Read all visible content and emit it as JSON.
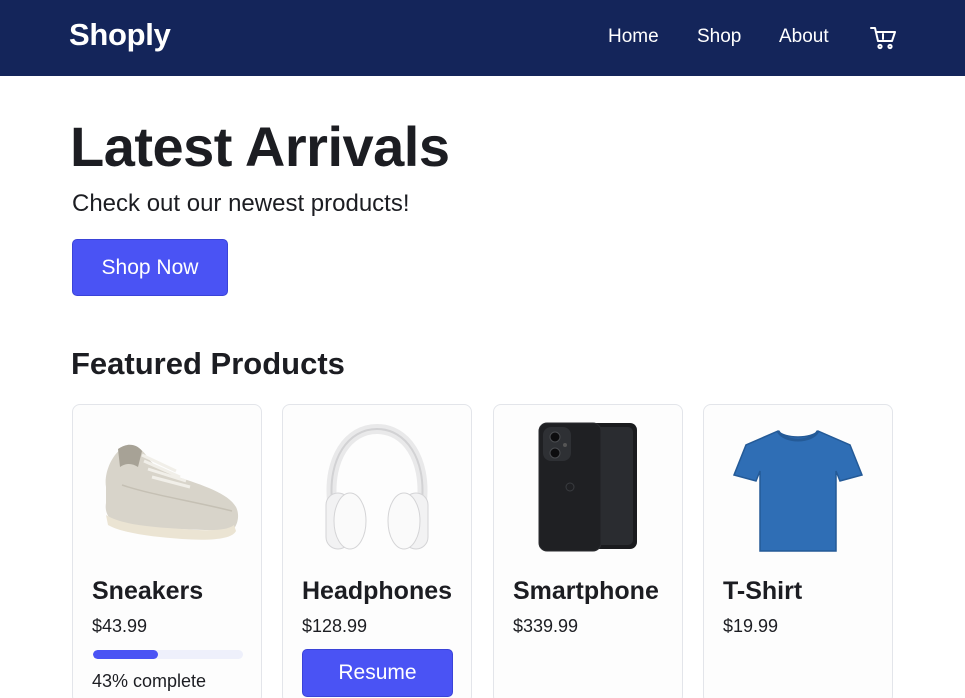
{
  "header": {
    "brand": "Shoply",
    "nav": [
      {
        "label": "Home"
      },
      {
        "label": "Shop"
      },
      {
        "label": "About"
      }
    ],
    "cart_icon": "cart-icon"
  },
  "hero": {
    "title": "Latest Arrivals",
    "subtitle": "Check out our newest products!",
    "cta_label": "Shop Now"
  },
  "featured": {
    "title": "Featured Products",
    "products": [
      {
        "name": "Sneakers",
        "price": "$43.99",
        "image_icon": "sneaker-icon",
        "progress": 0.43,
        "progress_label": "43% complete"
      },
      {
        "name": "Headphones",
        "price": "$128.99",
        "image_icon": "headphones-icon",
        "action_label": "Resume"
      },
      {
        "name": "Smartphone",
        "price": "$339.99",
        "image_icon": "smartphone-icon"
      },
      {
        "name": "T-Shirt",
        "price": "$19.99",
        "image_icon": "tshirt-icon"
      }
    ]
  },
  "colors": {
    "navbar": "#14255a",
    "accent": "#4a53f4",
    "text": "#1c1d22",
    "progress_track": "#eef0fb",
    "tshirt": "#2f6eb5"
  }
}
